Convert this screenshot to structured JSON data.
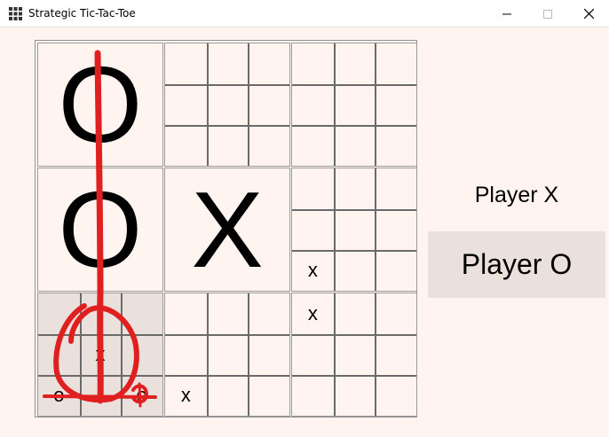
{
  "window": {
    "title": "Strategic Tic-Tac-Toe",
    "icon": "grid-icon",
    "controls": [
      "minimize-icon",
      "maximize-icon",
      "close-icon"
    ]
  },
  "board": {
    "big_boards": [
      {
        "winner": "O",
        "cells": [
          "",
          "",
          "",
          "",
          "",
          "",
          "",
          "",
          ""
        ]
      },
      {
        "winner": "",
        "cells": [
          "",
          "",
          "",
          "",
          "",
          "",
          "",
          "",
          ""
        ]
      },
      {
        "winner": "",
        "cells": [
          "",
          "",
          "",
          "",
          "",
          "",
          "",
          "",
          ""
        ]
      },
      {
        "winner": "O",
        "cells": [
          "",
          "",
          "",
          "",
          "",
          "",
          "",
          "",
          ""
        ]
      },
      {
        "winner": "X",
        "cells": [
          "",
          "",
          "",
          "",
          "",
          "",
          "",
          "",
          ""
        ]
      },
      {
        "winner": "",
        "cells": [
          "",
          "",
          "",
          "",
          "",
          "",
          "x",
          "",
          ""
        ]
      },
      {
        "winner": "",
        "active": true,
        "cells": [
          "",
          "",
          "",
          "",
          "x",
          "",
          "o",
          "",
          "o"
        ]
      },
      {
        "winner": "",
        "cells": [
          "",
          "",
          "",
          "",
          "",
          "",
          "x",
          "",
          ""
        ]
      },
      {
        "winner": "",
        "cells": [
          "x",
          "",
          "",
          "",
          "",
          "",
          "",
          "",
          ""
        ]
      }
    ]
  },
  "players": {
    "x_label": "Player X",
    "o_label": "Player O",
    "current": "O"
  },
  "colors": {
    "background": "#fff4ef",
    "active_board": "#ebe1dc",
    "annotation": "#e02020"
  }
}
